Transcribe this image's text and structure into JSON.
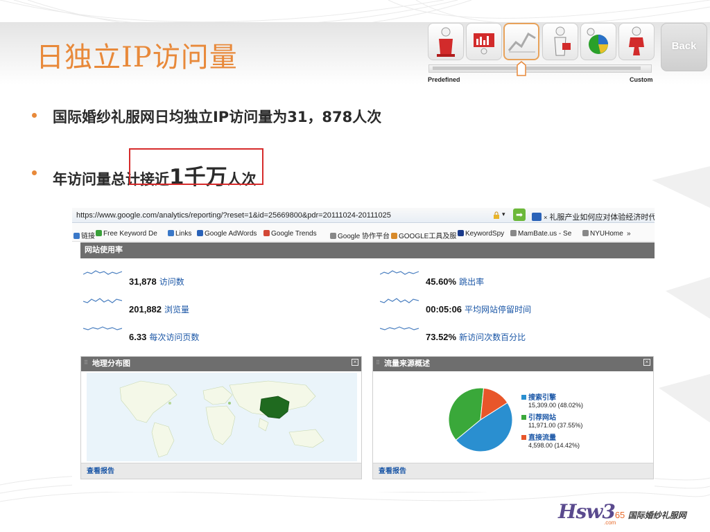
{
  "title": "日独立IP访问量",
  "icon_strip": {
    "icons": [
      "worker-icon",
      "presentation-board-icon",
      "line-chart-icon",
      "businessman-icon",
      "pie-chart-icon",
      "puzzle-person-icon"
    ],
    "selected_index": 2,
    "slider_left_label": "Predefined",
    "slider_right_label": "Custom",
    "back_label": "Back"
  },
  "bullets": [
    {
      "text": "国际婚纱礼服网日均独立IP访问量为31，878人次"
    },
    {
      "pre": "年访问量总计接近",
      "big": "1千万",
      "post": "人次"
    }
  ],
  "browser": {
    "url": "https://www.google.com/analytics/reporting/?reset=1&id=25669800&pdr=20111024-20111025",
    "tab_title": "礼服产业如何应对体验经济时代",
    "favorites": [
      {
        "label": "链接",
        "icon": "folder-icon",
        "color": "#3a78c8"
      },
      {
        "label": "Free Keyword De",
        "icon": "check-icon",
        "color": "#3aa03a"
      },
      {
        "label": "Links",
        "icon": "folder-icon",
        "color": "#3a78c8"
      },
      {
        "label": "Google AdWords",
        "icon": "google-icon",
        "color": "#2a62b8"
      },
      {
        "label": "Google Trends",
        "icon": "trends-icon",
        "color": "#d34836"
      },
      {
        "label": "Google 协作平台",
        "icon": "page-icon",
        "color": "#888888"
      },
      {
        "label": "GOOGLE工具及服",
        "icon": "tools-icon",
        "color": "#d88a2a"
      },
      {
        "label": "KeywordSpy",
        "icon": "ks-icon",
        "color": "#1a3a8a"
      },
      {
        "label": "MamBate.us - Se",
        "icon": "page-icon",
        "color": "#888888"
      },
      {
        "label": "NYUHome",
        "icon": "page-icon",
        "color": "#888888"
      },
      {
        "label": "»",
        "icon": "",
        "color": "#333333"
      }
    ]
  },
  "analytics": {
    "section_title": "网站使用率",
    "metrics_left": [
      {
        "value": "31,878",
        "label": "访问数"
      },
      {
        "value": "201,882",
        "label": "浏览量"
      },
      {
        "value": "6.33",
        "label": "每次访问页数"
      }
    ],
    "metrics_right": [
      {
        "value": "45.60%",
        "label": "跳出率"
      },
      {
        "value": "00:05:06",
        "label": "平均网站停留时间"
      },
      {
        "value": "73.52%",
        "label": "新访问次数百分比"
      }
    ],
    "map_panel": {
      "title": "地理分布图",
      "footer": "查看报告"
    },
    "traffic_panel": {
      "title": "流量来源概述",
      "footer": "查看报告"
    }
  },
  "chart_data": {
    "type": "pie",
    "title": "流量来源概述",
    "categories": [
      "搜索引擎",
      "引荐网站",
      "直接流量"
    ],
    "values": [
      15309.0,
      11971.0,
      4598.0
    ],
    "value_labels": [
      "15,309.00 (48.02%)",
      "11,971.00 (37.55%)",
      "4,598.00 (14.42%)"
    ],
    "colors": [
      "#2a8fd0",
      "#3aa83a",
      "#e8562a"
    ],
    "legend_placement": "right"
  },
  "logo": {
    "brand": "Hsw3",
    "brand_sup": "65",
    "tagline": "国际婚纱礼服网",
    "sub": ".com"
  },
  "colors": {
    "accent": "#e8893a",
    "highlight": "#d62b2b"
  }
}
